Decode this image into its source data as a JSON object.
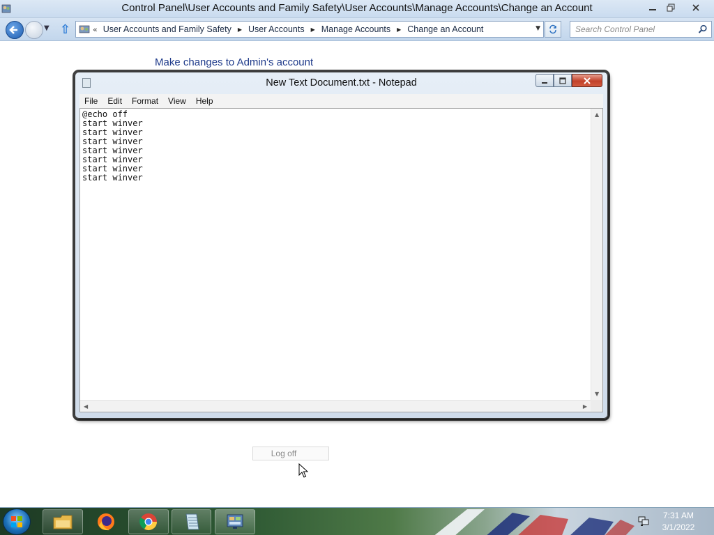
{
  "control_panel": {
    "title": "Control Panel\\User Accounts and Family Safety\\User Accounts\\Manage Accounts\\Change an Account",
    "breadcrumbs": [
      "User Accounts and Family Safety",
      "User Accounts",
      "Manage Accounts",
      "Change an Account"
    ],
    "search_placeholder": "Search Control Panel",
    "heading": "Make changes to Admin's account",
    "logoff_label": "Log off"
  },
  "notepad": {
    "title": "New Text Document.txt - Notepad",
    "menu": [
      "File",
      "Edit",
      "Format",
      "View",
      "Help"
    ],
    "content": "@echo off\nstart winver\nstart winver\nstart winver\nstart winver\nstart winver\nstart winver\nstart winver"
  },
  "taskbar": {
    "time": "7:31 AM",
    "date": "3/1/2022",
    "items": [
      "start-orb",
      "windows-explorer",
      "firefox",
      "chrome",
      "notepad",
      "control-panel"
    ]
  },
  "colors": {
    "heading_link": "#1e3a8a",
    "title_bar": "#c9dbef",
    "close_button": "#c2412a",
    "start_orb": "#1b6fb8"
  }
}
